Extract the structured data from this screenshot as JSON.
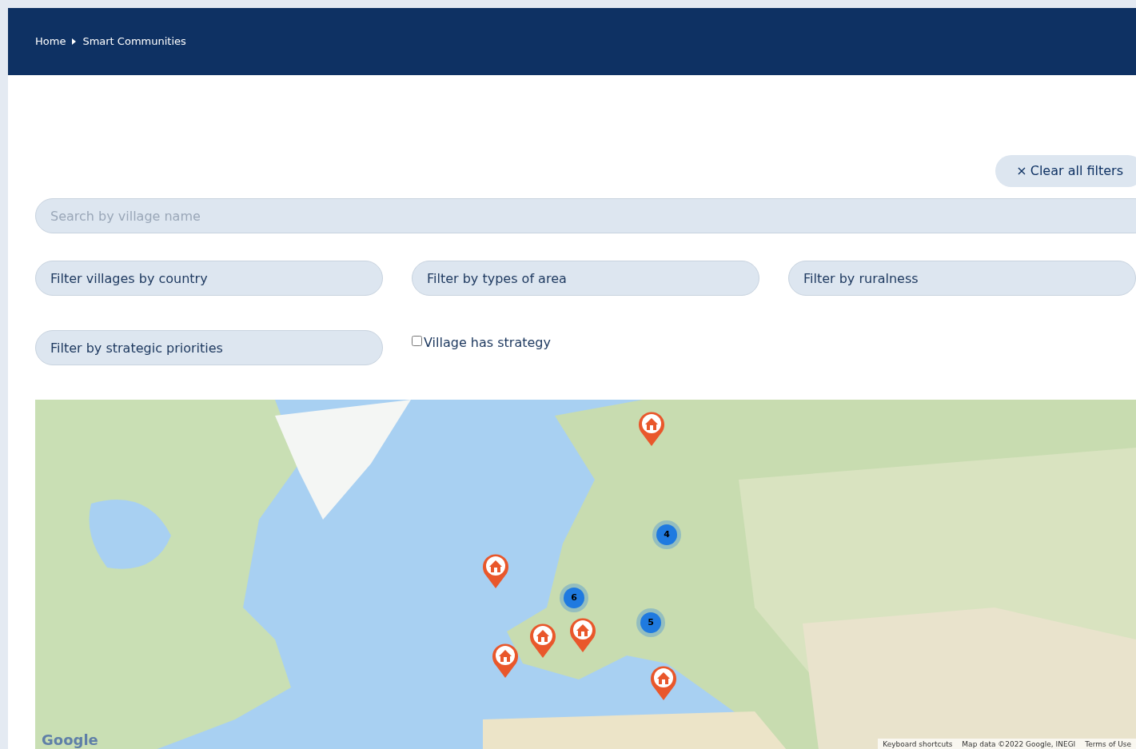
{
  "breadcrumb": {
    "items": [
      {
        "label": "Home"
      },
      {
        "label": "Smart Communities"
      }
    ]
  },
  "clear_filters": {
    "icon": "×",
    "label": "Clear all filters"
  },
  "search": {
    "placeholder": "Search by village name"
  },
  "filters": [
    {
      "placeholder": "Filter villages by country"
    },
    {
      "placeholder": "Filter by types of area"
    },
    {
      "placeholder": "Filter by ruralness"
    },
    {
      "placeholder": "Filter by strategic priorities"
    }
  ],
  "strategy_checkbox": {
    "label": "Village has strategy",
    "checked": false
  },
  "map": {
    "markers": [
      {
        "kind": "pin"
      },
      {
        "kind": "pin"
      },
      {
        "kind": "pin"
      },
      {
        "kind": "pin"
      },
      {
        "kind": "pin"
      },
      {
        "kind": "pin"
      },
      {
        "kind": "cluster",
        "count": "4"
      },
      {
        "kind": "cluster",
        "count": "6"
      },
      {
        "kind": "cluster",
        "count": "5"
      }
    ],
    "logo": "Google",
    "attribution": [
      "Keyboard shortcuts",
      "Map data ©2022 Google, INEGI",
      "Terms of Use"
    ]
  }
}
